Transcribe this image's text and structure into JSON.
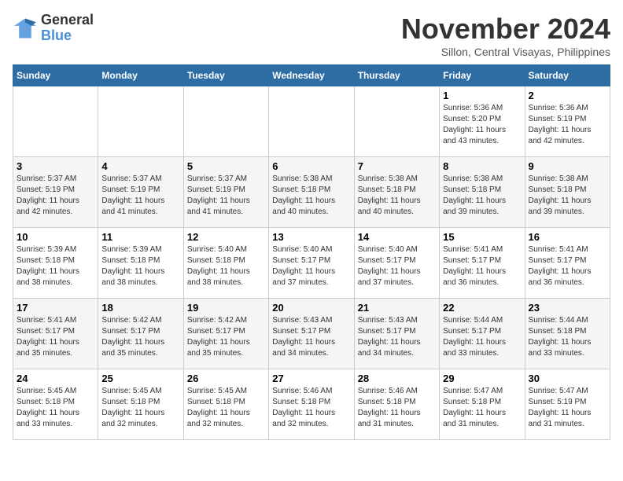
{
  "header": {
    "logo_line1": "General",
    "logo_line2": "Blue",
    "month": "November 2024",
    "location": "Sillon, Central Visayas, Philippines"
  },
  "weekdays": [
    "Sunday",
    "Monday",
    "Tuesday",
    "Wednesday",
    "Thursday",
    "Friday",
    "Saturday"
  ],
  "weeks": [
    [
      {
        "day": "",
        "info": ""
      },
      {
        "day": "",
        "info": ""
      },
      {
        "day": "",
        "info": ""
      },
      {
        "day": "",
        "info": ""
      },
      {
        "day": "",
        "info": ""
      },
      {
        "day": "1",
        "info": "Sunrise: 5:36 AM\nSunset: 5:20 PM\nDaylight: 11 hours\nand 43 minutes."
      },
      {
        "day": "2",
        "info": "Sunrise: 5:36 AM\nSunset: 5:19 PM\nDaylight: 11 hours\nand 42 minutes."
      }
    ],
    [
      {
        "day": "3",
        "info": "Sunrise: 5:37 AM\nSunset: 5:19 PM\nDaylight: 11 hours\nand 42 minutes."
      },
      {
        "day": "4",
        "info": "Sunrise: 5:37 AM\nSunset: 5:19 PM\nDaylight: 11 hours\nand 41 minutes."
      },
      {
        "day": "5",
        "info": "Sunrise: 5:37 AM\nSunset: 5:19 PM\nDaylight: 11 hours\nand 41 minutes."
      },
      {
        "day": "6",
        "info": "Sunrise: 5:38 AM\nSunset: 5:18 PM\nDaylight: 11 hours\nand 40 minutes."
      },
      {
        "day": "7",
        "info": "Sunrise: 5:38 AM\nSunset: 5:18 PM\nDaylight: 11 hours\nand 40 minutes."
      },
      {
        "day": "8",
        "info": "Sunrise: 5:38 AM\nSunset: 5:18 PM\nDaylight: 11 hours\nand 39 minutes."
      },
      {
        "day": "9",
        "info": "Sunrise: 5:38 AM\nSunset: 5:18 PM\nDaylight: 11 hours\nand 39 minutes."
      }
    ],
    [
      {
        "day": "10",
        "info": "Sunrise: 5:39 AM\nSunset: 5:18 PM\nDaylight: 11 hours\nand 38 minutes."
      },
      {
        "day": "11",
        "info": "Sunrise: 5:39 AM\nSunset: 5:18 PM\nDaylight: 11 hours\nand 38 minutes."
      },
      {
        "day": "12",
        "info": "Sunrise: 5:40 AM\nSunset: 5:18 PM\nDaylight: 11 hours\nand 38 minutes."
      },
      {
        "day": "13",
        "info": "Sunrise: 5:40 AM\nSunset: 5:17 PM\nDaylight: 11 hours\nand 37 minutes."
      },
      {
        "day": "14",
        "info": "Sunrise: 5:40 AM\nSunset: 5:17 PM\nDaylight: 11 hours\nand 37 minutes."
      },
      {
        "day": "15",
        "info": "Sunrise: 5:41 AM\nSunset: 5:17 PM\nDaylight: 11 hours\nand 36 minutes."
      },
      {
        "day": "16",
        "info": "Sunrise: 5:41 AM\nSunset: 5:17 PM\nDaylight: 11 hours\nand 36 minutes."
      }
    ],
    [
      {
        "day": "17",
        "info": "Sunrise: 5:41 AM\nSunset: 5:17 PM\nDaylight: 11 hours\nand 35 minutes."
      },
      {
        "day": "18",
        "info": "Sunrise: 5:42 AM\nSunset: 5:17 PM\nDaylight: 11 hours\nand 35 minutes."
      },
      {
        "day": "19",
        "info": "Sunrise: 5:42 AM\nSunset: 5:17 PM\nDaylight: 11 hours\nand 35 minutes."
      },
      {
        "day": "20",
        "info": "Sunrise: 5:43 AM\nSunset: 5:17 PM\nDaylight: 11 hours\nand 34 minutes."
      },
      {
        "day": "21",
        "info": "Sunrise: 5:43 AM\nSunset: 5:17 PM\nDaylight: 11 hours\nand 34 minutes."
      },
      {
        "day": "22",
        "info": "Sunrise: 5:44 AM\nSunset: 5:17 PM\nDaylight: 11 hours\nand 33 minutes."
      },
      {
        "day": "23",
        "info": "Sunrise: 5:44 AM\nSunset: 5:18 PM\nDaylight: 11 hours\nand 33 minutes."
      }
    ],
    [
      {
        "day": "24",
        "info": "Sunrise: 5:45 AM\nSunset: 5:18 PM\nDaylight: 11 hours\nand 33 minutes."
      },
      {
        "day": "25",
        "info": "Sunrise: 5:45 AM\nSunset: 5:18 PM\nDaylight: 11 hours\nand 32 minutes."
      },
      {
        "day": "26",
        "info": "Sunrise: 5:45 AM\nSunset: 5:18 PM\nDaylight: 11 hours\nand 32 minutes."
      },
      {
        "day": "27",
        "info": "Sunrise: 5:46 AM\nSunset: 5:18 PM\nDaylight: 11 hours\nand 32 minutes."
      },
      {
        "day": "28",
        "info": "Sunrise: 5:46 AM\nSunset: 5:18 PM\nDaylight: 11 hours\nand 31 minutes."
      },
      {
        "day": "29",
        "info": "Sunrise: 5:47 AM\nSunset: 5:18 PM\nDaylight: 11 hours\nand 31 minutes."
      },
      {
        "day": "30",
        "info": "Sunrise: 5:47 AM\nSunset: 5:19 PM\nDaylight: 11 hours\nand 31 minutes."
      }
    ]
  ]
}
